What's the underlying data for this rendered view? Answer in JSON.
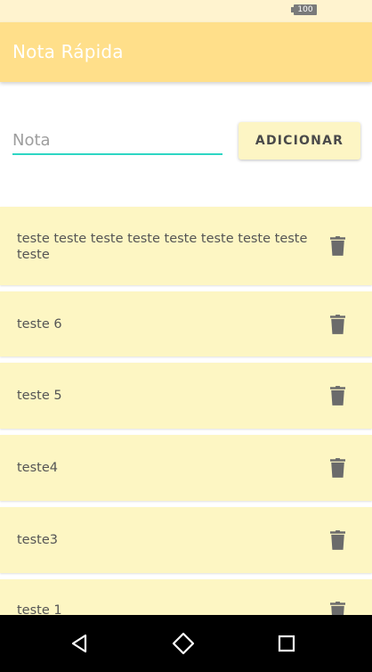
{
  "status_bar": {
    "battery": "100"
  },
  "app_bar": {
    "title": "Nota Rápida"
  },
  "input": {
    "placeholder": "Nota",
    "value": ""
  },
  "add_button": {
    "label": "ADICIONAR"
  },
  "notes": [
    {
      "text": "teste teste teste teste teste teste teste teste teste",
      "delete_icon": "trash-icon"
    },
    {
      "text": "teste 6",
      "delete_icon": "trash-icon"
    },
    {
      "text": "teste 5",
      "delete_icon": "trash-icon"
    },
    {
      "text": "teste4",
      "delete_icon": "trash-icon"
    },
    {
      "text": "teste3",
      "delete_icon": "trash-icon"
    },
    {
      "text": "teste 1",
      "delete_icon": "trash-icon"
    }
  ],
  "nav_bar": {
    "icons": [
      "back-icon",
      "home-icon",
      "recents-icon"
    ]
  },
  "colors": {
    "app_bar": "#ffdf8a",
    "card": "#fdf6c3",
    "accent": "#2ed6c4",
    "icon": "#6b6b6b"
  }
}
